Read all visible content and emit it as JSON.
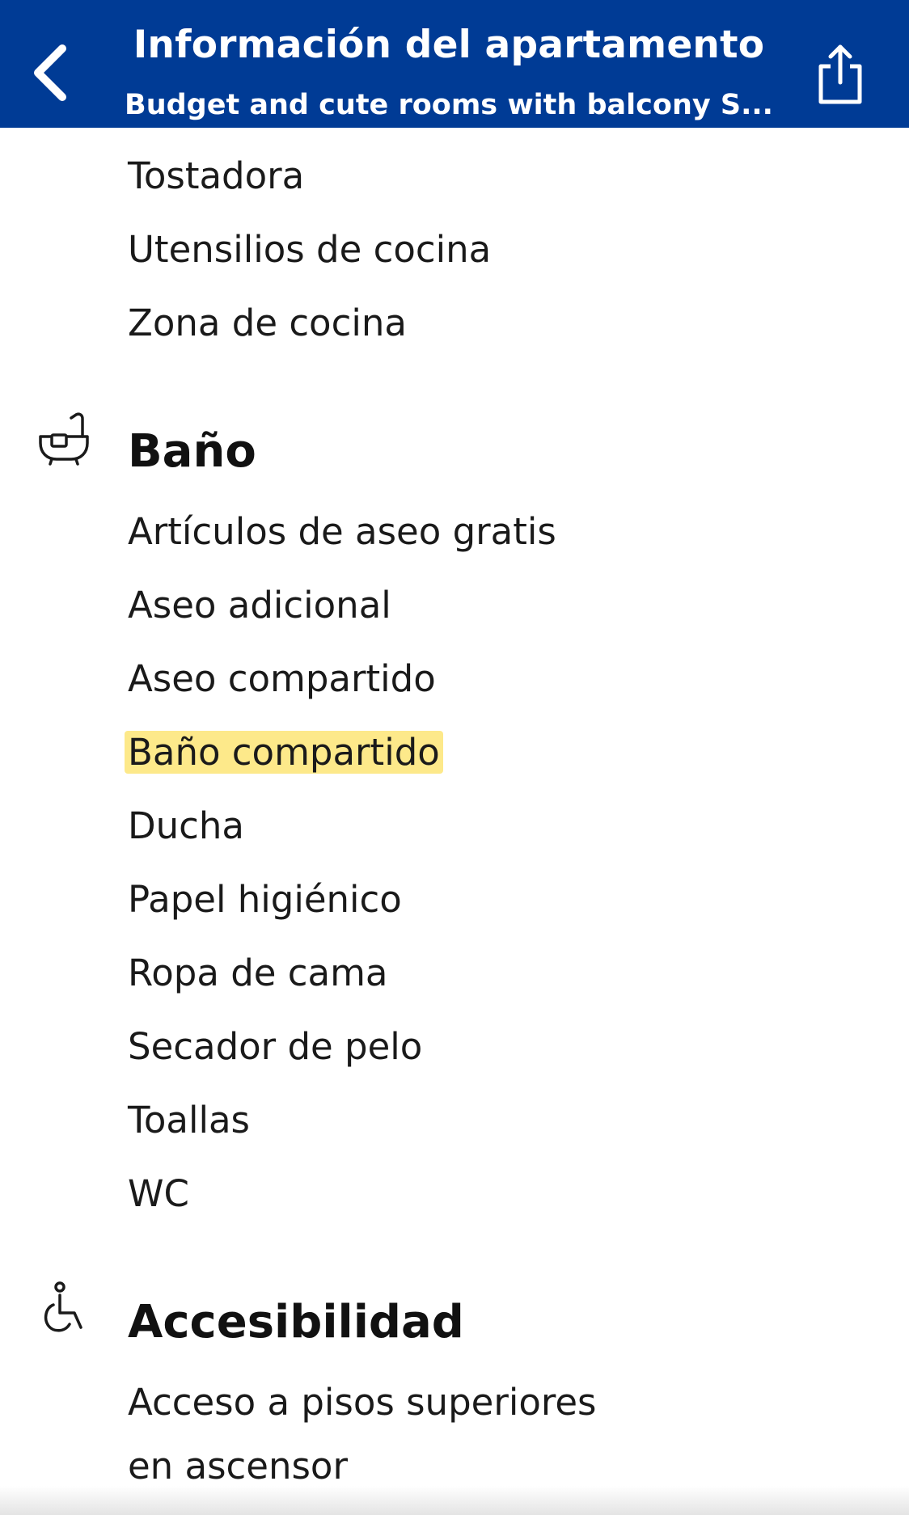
{
  "header": {
    "title": "Información del apartamento",
    "subtitle": "Budget and cute rooms with balcony S...",
    "background": "#003b95"
  },
  "previous_section": {
    "items": [
      "Tostadora",
      "Utensilios de cocina",
      "Zona de cocina"
    ]
  },
  "bathroom": {
    "icon": "bathtub-icon",
    "title": "Baño",
    "items": [
      "Artículos de aseo gratis",
      "Aseo adicional",
      "Aseo compartido",
      "Baño compartido",
      "Ducha",
      "Papel higiénico",
      "Ropa de cama",
      "Secador de pelo",
      "Toallas",
      "WC"
    ],
    "highlighted_item": "Baño compartido",
    "highlight_color": "#fde98a"
  },
  "accessibility": {
    "icon": "wheelchair-icon",
    "title": "Accesibilidad",
    "items": [
      "Acceso a pisos superiores",
      "en ascensor"
    ]
  }
}
